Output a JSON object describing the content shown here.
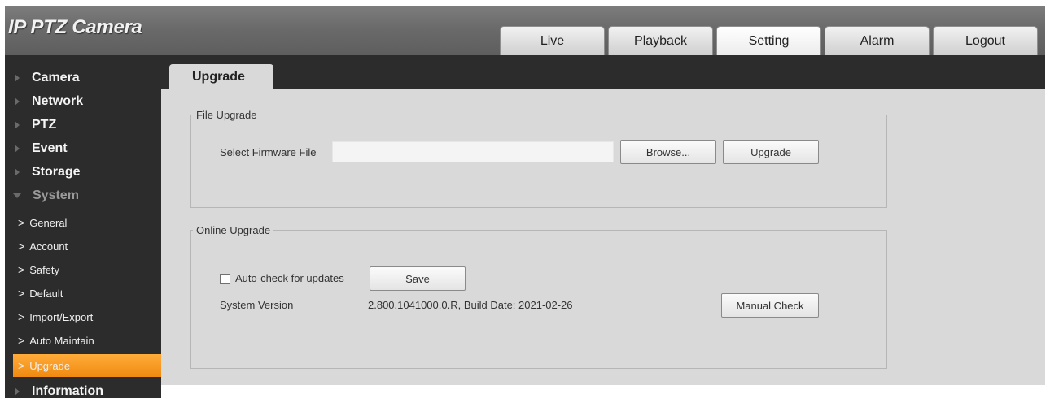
{
  "app": {
    "title": "IP PTZ Camera"
  },
  "top_tabs": [
    {
      "label": "Live",
      "active": false
    },
    {
      "label": "Playback",
      "active": false
    },
    {
      "label": "Setting",
      "active": true
    },
    {
      "label": "Alarm",
      "active": false
    },
    {
      "label": "Logout",
      "active": false
    }
  ],
  "sidebar": {
    "top_items": [
      {
        "label": "Camera"
      },
      {
        "label": "Network"
      },
      {
        "label": "PTZ"
      },
      {
        "label": "Event"
      },
      {
        "label": "Storage"
      }
    ],
    "expanded": {
      "label": "System"
    },
    "sub_items": [
      {
        "label": "General"
      },
      {
        "label": "Account"
      },
      {
        "label": "Safety"
      },
      {
        "label": "Default"
      },
      {
        "label": "Import/Export"
      },
      {
        "label": "Auto Maintain"
      },
      {
        "label": "Upgrade",
        "active": true
      }
    ],
    "bottom_items": [
      {
        "label": "Information"
      }
    ],
    "active_color": "#f59a23"
  },
  "page": {
    "tab_label": "Upgrade",
    "file_upgrade": {
      "legend": "File Upgrade",
      "select_label": "Select Firmware File",
      "file_value": "",
      "browse_label": "Browse...",
      "upgrade_label": "Upgrade"
    },
    "online_upgrade": {
      "legend": "Online Upgrade",
      "auto_check_label": "Auto-check for updates",
      "auto_check_checked": false,
      "save_label": "Save",
      "version_label": "System Version",
      "version_value": "2.800.1041000.0.R, Build Date: 2021-02-26",
      "manual_check_label": "Manual Check"
    }
  }
}
